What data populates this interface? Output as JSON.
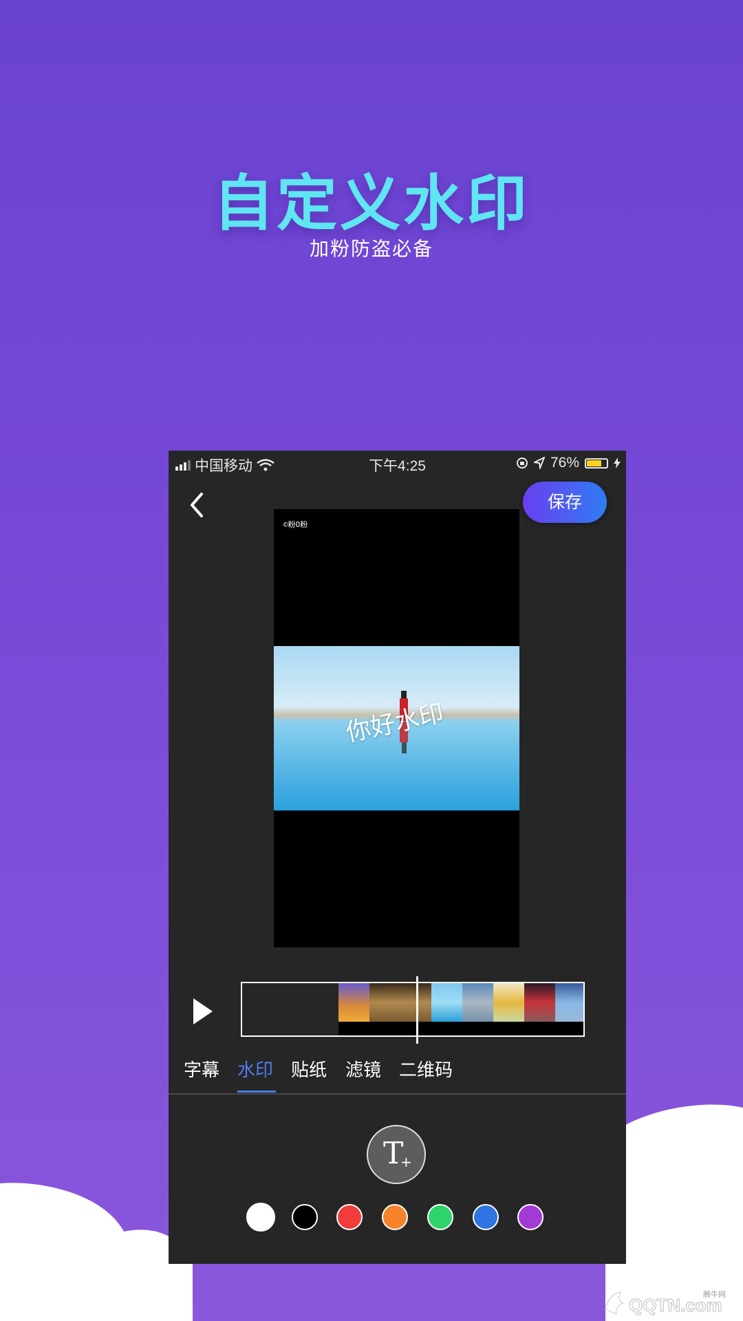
{
  "promo": {
    "title": "自定义水印",
    "subtitle": "加粉防盗必备"
  },
  "status_bar": {
    "carrier": "中国移动",
    "time": "下午4:25",
    "battery": "76%",
    "battery_level": 0.76
  },
  "toolbar": {
    "back_icon": "chevron-left-icon",
    "save_label": "保存"
  },
  "preview": {
    "logo_text": "©粉O粉",
    "watermark_text": "你好水印"
  },
  "timeline": {
    "play_icon": "play-icon"
  },
  "tabs": [
    {
      "label": "字幕",
      "active": false
    },
    {
      "label": "水印",
      "active": true
    },
    {
      "label": "贴纸",
      "active": false
    },
    {
      "label": "滤镜",
      "active": false
    },
    {
      "label": "二维码",
      "active": false
    }
  ],
  "add_text_icon": "text-add-icon",
  "colors": [
    "#ffffff",
    "#000000",
    "#f23b3b",
    "#f7832a",
    "#2ed36b",
    "#2f74e0",
    "#a43ad6"
  ],
  "selected_color": "#ffffff",
  "site_watermark": {
    "brand": "QQTN.com",
    "cn": "腾牛网"
  }
}
